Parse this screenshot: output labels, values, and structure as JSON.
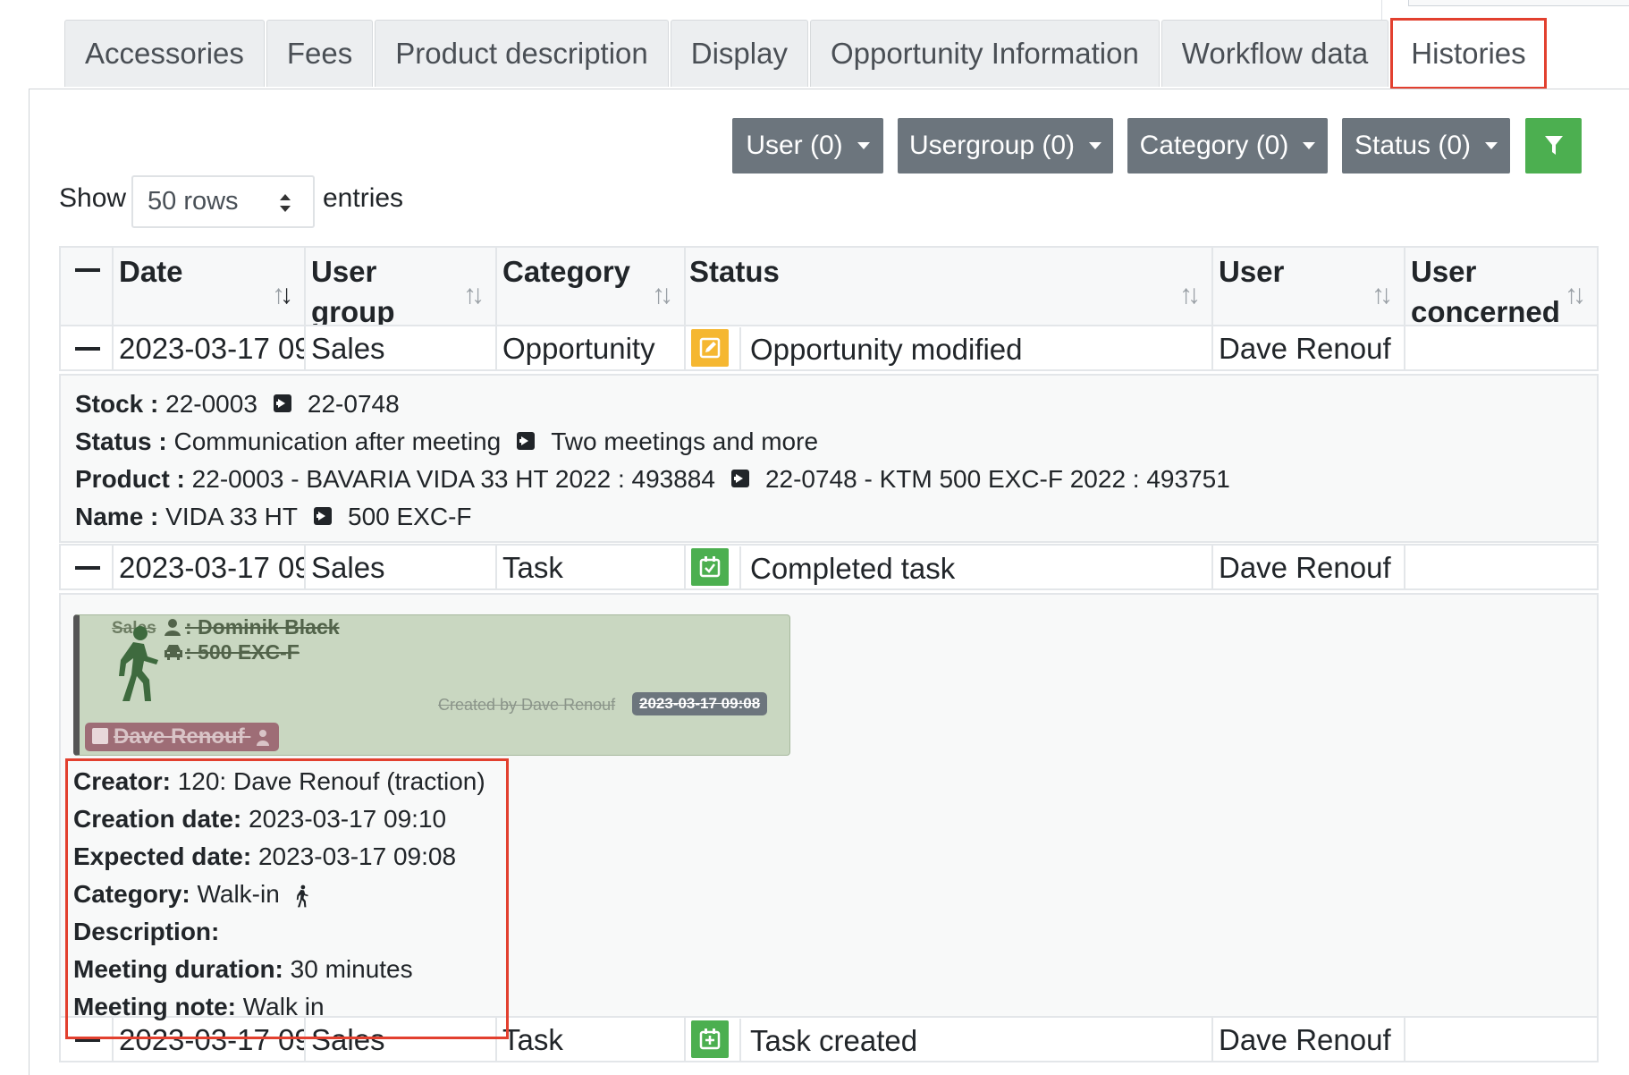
{
  "tabs": [
    "Accessories",
    "Fees",
    "Product description",
    "Display",
    "Opportunity Information",
    "Workflow data",
    "Histories"
  ],
  "active_tab": "Histories",
  "filters": {
    "user": "User (0)",
    "usergroup": "Usergroup (0)",
    "category": "Category (0)",
    "status": "Status (0)",
    "filter_icon": "funnel-icon"
  },
  "length": {
    "show": "Show",
    "rows": "50 rows",
    "entries": "entries"
  },
  "table": {
    "headers": {
      "toggle": "—",
      "date": "Date",
      "user_group_1": "User",
      "user_group_2": "group",
      "category": "Category",
      "status": "Status",
      "user": "User",
      "user_concerned_1": "User",
      "user_concerned_2": "concerned"
    },
    "rows": [
      {
        "date": "2023-03-17 09:",
        "group": "Sales",
        "category": "Opportunity",
        "status": "Opportunity modified",
        "user": "Dave Renouf",
        "concerned": "",
        "icon_color": "#f5b731"
      },
      {
        "date": "2023-03-17 09:",
        "group": "Sales",
        "category": "Task",
        "status": "Completed task",
        "user": "Dave Renouf",
        "concerned": "",
        "icon_color": "#4caf50"
      },
      {
        "date": "2023-03-17 09:",
        "group": "Sales",
        "category": "Task",
        "status": "Task created",
        "user": "Dave Renouf",
        "concerned": "",
        "icon_color": "#4caf50"
      }
    ]
  },
  "modified_details": {
    "stock_label": "Stock :",
    "stock_from": "22-0003",
    "stock_to": "22-0748",
    "status_label": "Status :",
    "status_from": "Communication after meeting",
    "status_to": "Two meetings and more",
    "product_label": "Product :",
    "product_from": "22-0003 - BAVARIA VIDA 33 HT 2022 : 493884",
    "product_to": "22-0748 - KTM 500 EXC-F 2022 : 493751",
    "name_label": "Name :",
    "name_from": "VIDA 33 HT",
    "name_to": "500 EXC-F"
  },
  "task_card": {
    "group": "Sales",
    "contact": ": Dominik Black",
    "vehicle": ": 500 EXC-F",
    "created_by": "Created by Dave Renouf",
    "date": "2023-03-17 09:08",
    "assignee": "Dave Renouf"
  },
  "task_info": {
    "creator_label": "Creator:",
    "creator": "120: Dave Renouf (traction)",
    "creation_label": "Creation date:",
    "creation": "2023-03-17 09:10",
    "expected_label": "Expected date:",
    "expected": "2023-03-17 09:08",
    "category_label": "Category:",
    "category": "Walk-in",
    "description_label": "Description:",
    "description": "",
    "duration_label": "Meeting duration:",
    "duration": "30 minutes",
    "note_label": "Meeting note:",
    "note": "Walk in"
  }
}
